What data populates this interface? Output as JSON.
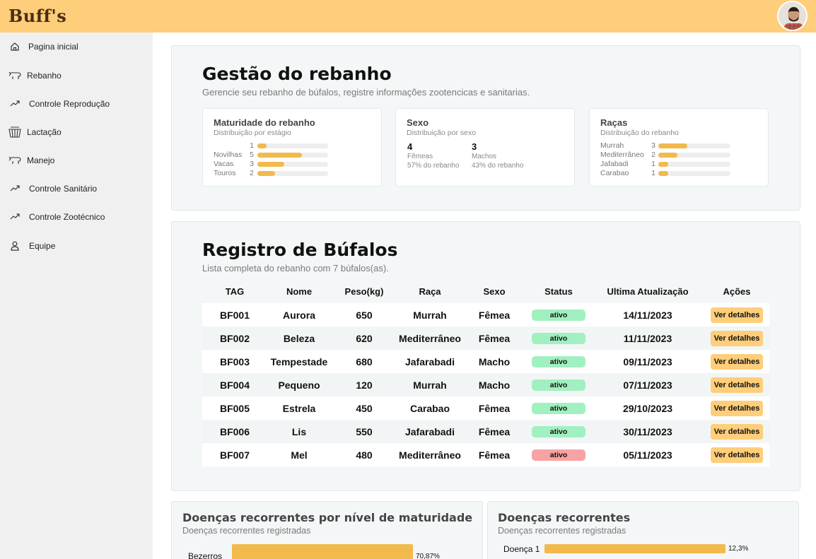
{
  "header": {
    "logo": "Buff's"
  },
  "sidebar": {
    "items": [
      {
        "label": "Pagina inicial",
        "icon": "home-icon"
      },
      {
        "label": "Rebanho",
        "icon": "buffalo-icon"
      },
      {
        "label": "Controle Reprodução",
        "icon": "trend-icon"
      },
      {
        "label": "Lactação",
        "icon": "milk-basket-icon"
      },
      {
        "label": "Manejo",
        "icon": "buffalo-icon"
      },
      {
        "label": "Controle Sanitário",
        "icon": "trend-icon"
      },
      {
        "label": "Controle Zootécnico",
        "icon": "trend-icon"
      },
      {
        "label": "Equipe",
        "icon": "user-icon"
      }
    ]
  },
  "overview": {
    "title": "Gestão do rebanho",
    "subtitle": "Gerencie seu rebanho de búfalos, registre informações zootencicas e sanitarias.",
    "maturity": {
      "title": "Maturidade do rebanho",
      "subtitle": "Distribuição por estágio",
      "rows": [
        {
          "label": "",
          "count": "1",
          "value": 1
        },
        {
          "label": "Novilhas",
          "count": "5",
          "value": 5
        },
        {
          "label": "Vacas",
          "count": "3",
          "value": 3
        },
        {
          "label": "Touros",
          "count": "2",
          "value": 2
        }
      ],
      "max": 8
    },
    "sex": {
      "title": "Sexo",
      "subtitle": "Distribuição por sexo",
      "female_count": "4",
      "female_label": "Fêmeas",
      "female_pct": "57% do rebanho",
      "male_count": "3",
      "male_label": "Machos",
      "male_pct": "43% do rebanho"
    },
    "breeds": {
      "title": "Raças",
      "subtitle": "Distribuição do rebanho",
      "rows": [
        {
          "label": "Murrah",
          "count": "3",
          "value": 3
        },
        {
          "label": "Mediterrâneo",
          "count": "2",
          "value": 2
        },
        {
          "label": "Jafabadi",
          "count": "1",
          "value": 1
        },
        {
          "label": "Carabao",
          "count": "1",
          "value": 1
        }
      ],
      "max": 7.5
    }
  },
  "registry": {
    "title": "Registro de Búfalos",
    "subtitle": "Lista completa do rebanho com 7 búfalos(as).",
    "columns": [
      "TAG",
      "Nome",
      "Peso(kg)",
      "Raça",
      "Sexo",
      "Status",
      "Ultima Atualização",
      "Ações"
    ],
    "rows": [
      {
        "tag": "BF001",
        "name": "Aurora",
        "weight": "650",
        "breed": "Murrah",
        "sex": "Fêmea",
        "status": "ativo",
        "status_color": "#a1f0c0",
        "updated": "14/11/2023",
        "action": "Ver detalhes"
      },
      {
        "tag": "BF002",
        "name": "Beleza",
        "weight": "620",
        "breed": "Mediterrâneo",
        "sex": "Fêmea",
        "status": "ativo",
        "status_color": "#a1f0c0",
        "updated": "11/11/2023",
        "action": "Ver detalhes"
      },
      {
        "tag": "BF003",
        "name": "Tempestade",
        "weight": "680",
        "breed": "Jafarabadi",
        "sex": "Macho",
        "status": "ativo",
        "status_color": "#a1f0c0",
        "updated": "09/11/2023",
        "action": "Ver detalhes"
      },
      {
        "tag": "BF004",
        "name": "Pequeno",
        "weight": "120",
        "breed": "Murrah",
        "sex": "Macho",
        "status": "ativo",
        "status_color": "#a1f0c0",
        "updated": "07/11/2023",
        "action": "Ver detalhes"
      },
      {
        "tag": "BF005",
        "name": "Estrela",
        "weight": "450",
        "breed": "Carabao",
        "sex": "Fêmea",
        "status": "ativo",
        "status_color": "#a1f0c0",
        "updated": "29/10/2023",
        "action": "Ver detalhes"
      },
      {
        "tag": "BF006",
        "name": "Lis",
        "weight": "550",
        "breed": "Jafarabadi",
        "sex": "Fêmea",
        "status": "ativo",
        "status_color": "#a1f0c0",
        "updated": "30/11/2023",
        "action": "Ver detalhes"
      },
      {
        "tag": "BF007",
        "name": "Mel",
        "weight": "480",
        "breed": "Mediterrâneo",
        "sex": "Fêmea",
        "status": "ativo",
        "status_color": "#f8a3a3",
        "updated": "05/11/2023",
        "action": "Ver detalhes"
      }
    ]
  },
  "disease_maturity": {
    "title": "Doenças recorrentes por nível de maturidade",
    "subtitle": "Doenças recorrentes registradas",
    "rows": [
      {
        "label": "Bezerros",
        "value": 70.87,
        "value_label": "70,87%"
      }
    ]
  },
  "disease_recurrent": {
    "title": "Doenças recorrentes",
    "subtitle": "Doenças recorrentes registradas",
    "rows": [
      {
        "label": "Doença 1",
        "value": 12.3,
        "value_label": "12,3%"
      }
    ]
  },
  "colors": {
    "brand": "#fece7a",
    "bar": "#f2b94c",
    "active": "#a1f0c0",
    "inactive": "#f8a3a3"
  }
}
